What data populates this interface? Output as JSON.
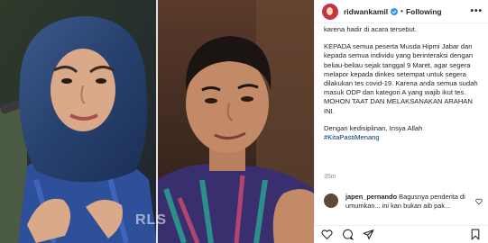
{
  "post": {
    "username": "ridwankamil",
    "separator": "•",
    "follow_label": "Following",
    "more_label": "•••",
    "caption_lines": [
      "karena hadir di acara tersebut.",
      "KEPADA semua peserta Musda Hipmi Jabar dan kepada semua individu yang berinteraksi dengan beliau-beliau sejak tanggal 9 Maret, agar segera melapor kepada dinkes setempat untuk segera dilakukan tes covid-19. Karena anda semua sudah masuk ODP dan kategori A yang wajib ikut tes. MOHON TAAT DAN MELAKSANAKAN ARAHAN INI.",
      "Dengan kedisiplinan, Insya Allah"
    ],
    "hashtag": "#KitaPastiMenang",
    "time_ago": "35m",
    "watermark": "RLS"
  },
  "comment": {
    "username": "japen_pernando",
    "text": "Bagusnya penderita di umumkan... ini kan bukan aib pak..."
  },
  "icons": [
    "verified-badge-icon",
    "heart-icon",
    "comment-icon",
    "share-icon",
    "bookmark-icon"
  ],
  "colors": {
    "verified": "#3897f0",
    "hashtag": "#00376b",
    "muted": "#8e8e8e",
    "border": "#efefef"
  }
}
